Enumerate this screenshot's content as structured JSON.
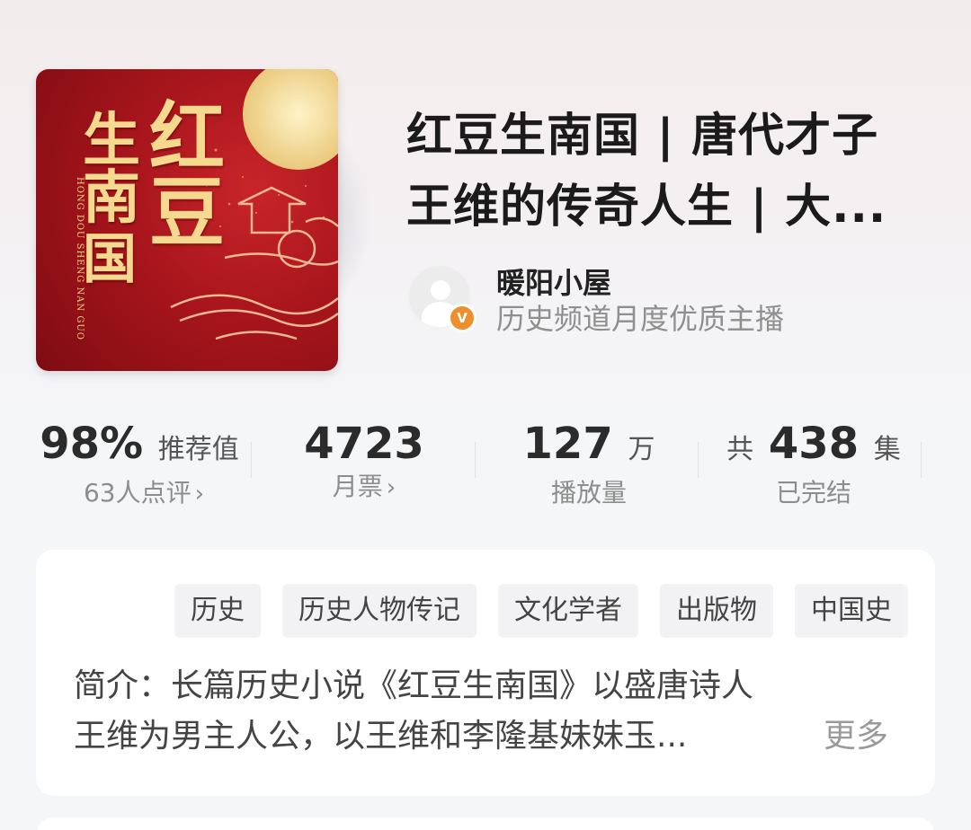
{
  "book": {
    "cover_title_chars": [
      "红",
      "豆",
      "生",
      "南",
      "国"
    ],
    "cover_pinyin": "HONG DOU SHENG NAN GUO",
    "title_line1": "红豆生南国 | 唐代才子",
    "title_line2": "王维的传奇人生 | 大..."
  },
  "author": {
    "name": "暖阳小屋",
    "description": "历史频道月度优质主播",
    "badge": "V"
  },
  "stats": {
    "recommend_value": "98%",
    "recommend_label": "推荐值",
    "review_count": "63人点评",
    "monthly_votes": "4723",
    "monthly_votes_label": "月票",
    "plays_number": "127",
    "plays_unit": "万",
    "plays_label": "播放量",
    "episodes_prefix": "共",
    "episodes_count": "438",
    "episodes_unit": "集",
    "status": "已完结"
  },
  "tags": [
    "历史",
    "历史人物传记",
    "文化学者",
    "出版物",
    "中国史"
  ],
  "intro": {
    "line1": "简介：长篇历史小说《红豆生南国》以盛唐诗人",
    "line2": "王维为男主人公，以王维和李隆基妹妹玉...",
    "more_label": "更多"
  },
  "colors": {
    "cover_red": "#a8151c",
    "cover_gold": "#f4d98f",
    "badge_orange": "#ef8f2c"
  }
}
